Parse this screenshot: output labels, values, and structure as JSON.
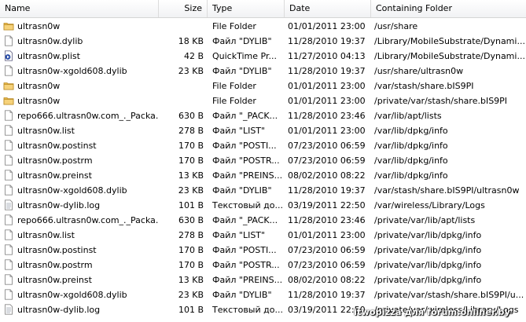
{
  "columns": {
    "name": "Name",
    "size": "Size",
    "type": "Type",
    "date": "Date",
    "folder": "Containing Folder"
  },
  "rows": [
    {
      "icon": "folder-icon",
      "name": "ultrasn0w",
      "size": "",
      "type": "File Folder",
      "date": "01/01/2011  23:00",
      "folder": "/usr/share"
    },
    {
      "icon": "file-icon",
      "name": "ultrasn0w.dylib",
      "size": "18 KB",
      "type": "Файл \"DYLIB\"",
      "date": "11/28/2010  19:37",
      "folder": "/Library/MobileSubstrate/Dynami..."
    },
    {
      "icon": "plist-icon",
      "name": "ultrasn0w.plist",
      "size": "42 B",
      "type": "QuickTime Pr...",
      "date": "11/27/2010  04:13",
      "folder": "/Library/MobileSubstrate/Dynami..."
    },
    {
      "icon": "file-icon",
      "name": "ultrasn0w-xgold608.dylib",
      "size": "23 KB",
      "type": "Файл \"DYLIB\"",
      "date": "11/28/2010  19:37",
      "folder": "/usr/share/ultrasn0w"
    },
    {
      "icon": "folder-icon",
      "name": "ultrasn0w",
      "size": "",
      "type": "File Folder",
      "date": "01/01/2011  23:00",
      "folder": "/var/stash/share.bIS9PI"
    },
    {
      "icon": "folder-icon",
      "name": "ultrasn0w",
      "size": "",
      "type": "File Folder",
      "date": "01/01/2011  23:00",
      "folder": "/private/var/stash/share.bIS9PI"
    },
    {
      "icon": "file-icon",
      "name": "repo666.ultrasn0w.com_._Packa...",
      "size": "630 B",
      "type": "Файл \"_PACK...",
      "date": "11/28/2010  23:46",
      "folder": "/var/lib/apt/lists"
    },
    {
      "icon": "file-icon",
      "name": "ultrasn0w.list",
      "size": "278 B",
      "type": "Файл \"LIST\"",
      "date": "01/01/2011  23:00",
      "folder": "/var/lib/dpkg/info"
    },
    {
      "icon": "file-icon",
      "name": "ultrasn0w.postinst",
      "size": "170 B",
      "type": "Файл \"POSTI...",
      "date": "07/23/2010  06:59",
      "folder": "/var/lib/dpkg/info"
    },
    {
      "icon": "file-icon",
      "name": "ultrasn0w.postrm",
      "size": "170 B",
      "type": "Файл \"POSTR...",
      "date": "07/23/2010  06:59",
      "folder": "/var/lib/dpkg/info"
    },
    {
      "icon": "file-icon",
      "name": "ultrasn0w.preinst",
      "size": "13 KB",
      "type": "Файл \"PREINS...",
      "date": "08/02/2010  08:22",
      "folder": "/var/lib/dpkg/info"
    },
    {
      "icon": "file-icon",
      "name": "ultrasn0w-xgold608.dylib",
      "size": "23 KB",
      "type": "Файл \"DYLIB\"",
      "date": "11/28/2010  19:37",
      "folder": "/var/stash/share.bIS9PI/ultrasn0w"
    },
    {
      "icon": "text-file-icon",
      "name": "ultrasn0w-dylib.log",
      "size": "101 B",
      "type": "Текстовый до...",
      "date": "03/19/2011  22:50",
      "folder": "/var/wireless/Library/Logs"
    },
    {
      "icon": "file-icon",
      "name": "repo666.ultrasn0w.com_._Packa...",
      "size": "630 B",
      "type": "Файл \"_PACK...",
      "date": "11/28/2010  23:46",
      "folder": "/private/var/lib/apt/lists"
    },
    {
      "icon": "file-icon",
      "name": "ultrasn0w.list",
      "size": "278 B",
      "type": "Файл \"LIST\"",
      "date": "01/01/2011  23:00",
      "folder": "/private/var/lib/dpkg/info"
    },
    {
      "icon": "file-icon",
      "name": "ultrasn0w.postinst",
      "size": "170 B",
      "type": "Файл \"POSTI...",
      "date": "07/23/2010  06:59",
      "folder": "/private/var/lib/dpkg/info"
    },
    {
      "icon": "file-icon",
      "name": "ultrasn0w.postrm",
      "size": "170 B",
      "type": "Файл \"POSTR...",
      "date": "07/23/2010  06:59",
      "folder": "/private/var/lib/dpkg/info"
    },
    {
      "icon": "file-icon",
      "name": "ultrasn0w.preinst",
      "size": "13 KB",
      "type": "Файл \"PREINS...",
      "date": "08/02/2010  08:22",
      "folder": "/private/var/lib/dpkg/info"
    },
    {
      "icon": "file-icon",
      "name": "ultrasn0w-xgold608.dylib",
      "size": "23 KB",
      "type": "Файл \"DYLIB\"",
      "date": "11/28/2010  19:37",
      "folder": "/private/var/stash/share.bIS9PI/u..."
    },
    {
      "icon": "text-file-icon",
      "name": "ultrasn0w-dylib.log",
      "size": "101 B",
      "type": "Текстовый до...",
      "date": "03/19/2011  22:50",
      "folder": "/private/var/wireless/Library/Logs"
    }
  ],
  "watermark": "itwopizza для forum.onliner.by"
}
